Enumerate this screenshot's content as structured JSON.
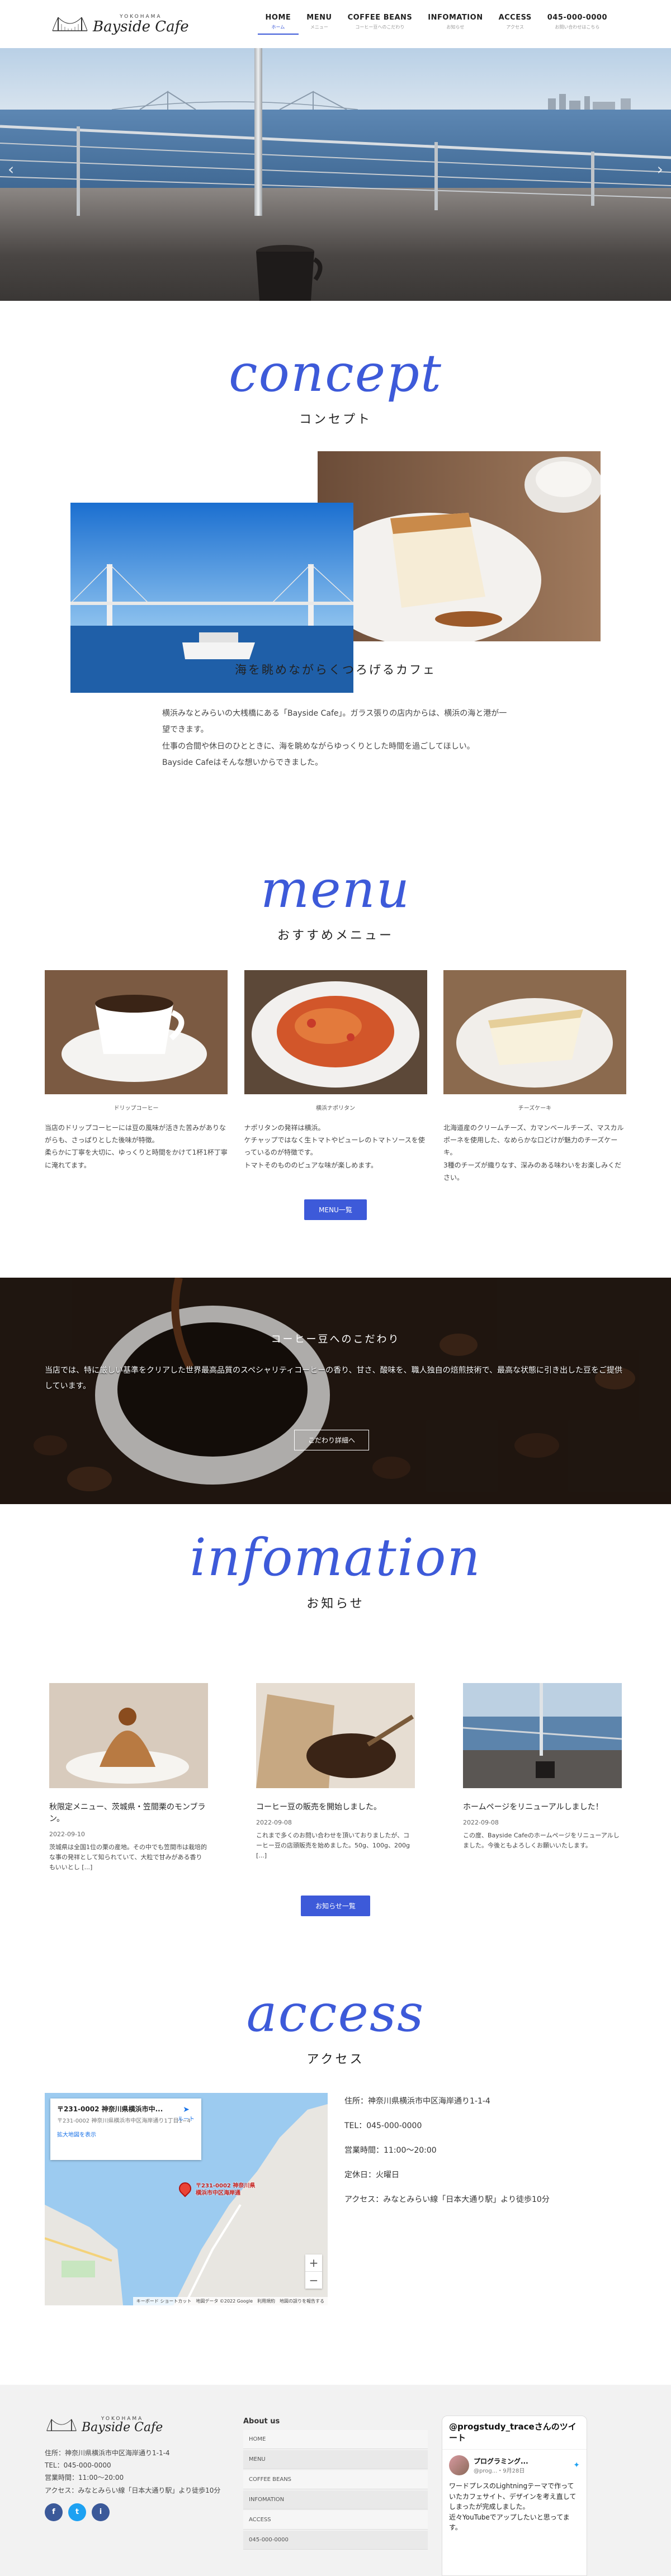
{
  "header": {
    "logo_sub": "YOKOHAMA",
    "logo_name": "Bayside Cafe",
    "nav": [
      {
        "en": "HOME",
        "ja": "ホーム"
      },
      {
        "en": "MENU",
        "ja": "メニュー"
      },
      {
        "en": "COFFEE BEANS",
        "ja": "コーヒー豆へのこだわり"
      },
      {
        "en": "INFOMATION",
        "ja": "お知らせ"
      },
      {
        "en": "ACCESS",
        "ja": "アクセス"
      },
      {
        "en": "045-000-0000",
        "ja": "お問い合わせはこちら"
      }
    ]
  },
  "hero": {
    "prev": "‹",
    "next": "›"
  },
  "concept": {
    "script": "concept",
    "sub": "コンセプト",
    "heading": "海を眺めながらくつろげるカフェ",
    "text": [
      "横浜みなとみらいの大桟橋にある「Bayside Cafe」。ガラス張りの店内からは、横浜の海と港が一望できます。",
      "仕事の合間や休日のひとときに、海を眺めながらゆっくりとした時間を過ごしてほしい。",
      "Bayside Cafeはそんな想いからできました。"
    ]
  },
  "menu": {
    "script": "menu",
    "sub": "おすすめメニュー",
    "items": [
      {
        "caption": "ドリップコーヒー",
        "desc": "当店のドリップコーヒーには豆の風味が活きた苦みがありながらも、さっぱりとした後味が特徴。\n柔らかに丁寧を大切に、ゆっくりと時間をかけて1杯1杯丁寧に淹れてます。"
      },
      {
        "caption": "横浜ナポリタン",
        "desc": "ナポリタンの発祥は横浜。\nケチャップではなく生トマトやピューレのトマトソースを使っているのが特徴です。\nトマトそのもののピュアな味が楽しめます。"
      },
      {
        "caption": "チーズケーキ",
        "desc": "北海道産のクリームチーズ、カマンベールチーズ、マスカルポーネを使用した、なめらかな口どけが魅力のチーズケーキ。\n3種のチーズが織りなす、深みのある味わいをお楽しみください。"
      }
    ],
    "button": "MENU一覧"
  },
  "coffee": {
    "title": "コーヒー豆へのこだわり",
    "text": "当店では、特に厳しい基準をクリアした世界最高品質のスペシャリティコーヒーの香り、甘さ、酸味を、職人独自の焙煎技術で、最高な状態に引き出した豆をご提供しています。",
    "button": "こだわり詳細へ"
  },
  "info": {
    "script": "infomation",
    "sub": "お知らせ",
    "items": [
      {
        "title": "秋限定メニュー、茨城県・笠間栗のモンブラン。",
        "date": "2022-09-10",
        "text": "茨城県は全国1位の栗の産地。その中でも笠間市は栽培的な事の発祥として知られていて、大粒で甘みがある香りもいいとし [...]"
      },
      {
        "title": "コーヒー豆の販売を開始しました。",
        "date": "2022-09-08",
        "text": "これまで多くのお問い合わせを頂いておりましたが、コーヒー豆の店頭販売を始めました。50g、100g、200g [...]"
      },
      {
        "title": "ホームページをリニューアルしました！",
        "date": "2022-09-08",
        "text": "この度、Bayside Cafeのホームページをリニューアルしました。今後ともよろしくお願いいたします。"
      }
    ],
    "button": "お知らせ一覧"
  },
  "access": {
    "script": "access",
    "sub": "アクセス",
    "map_title": "〒231-0002 神奈川県横浜市中...",
    "map_addr": "〒231-0002 神奈川県横浜市中区海岸通り1丁目1−4",
    "map_link": "拡大地図を表示",
    "map_route": "ルート",
    "map_pin": "〒231-0002 神奈川県横浜市中区海岸通",
    "map_attr": "キーボード ショートカット　地図データ ©2022 Google　利用規約　地図の誤りを報告する",
    "lines": [
      "住所：神奈川県横浜市中区海岸通り1-1-4",
      "TEL：045-000-0000",
      "営業時間：11:00〜20:00",
      "定休日：火曜日",
      "アクセス：みなとみらい線「日本大通り駅」より徒歩10分"
    ]
  },
  "footer": {
    "logo_sub": "YOKOHAMA",
    "logo_name": "Bayside Cafe",
    "info": [
      "住所：神奈川県横浜市中区海岸通り1-1-4",
      "TEL：045-000-0000",
      "営業時間：11:00〜20:00",
      "アクセス：みなとみらい線「日本大通り駅」より徒歩10分"
    ],
    "social": [
      "f",
      "t",
      "i"
    ],
    "about_title": "About us",
    "links": [
      "HOME",
      "MENU",
      "COFFEE BEANS",
      "INFOMATION",
      "ACCESS",
      "045-000-0000"
    ],
    "tw_title": "@progstudy_traceさんのツイート",
    "tw_name": "プログラミング...",
    "tw_handle": "@prog...・9月28日",
    "tw_body": "ワードプレスのLightningテーマで作っていたカフェサイト、デザインを考え直してしまったが完成しました。\n近々YouTubeでアップしたいと思ってます。"
  },
  "colors": {
    "accent": "#3d5ad9",
    "footer_bg": "#f2f2f2"
  }
}
